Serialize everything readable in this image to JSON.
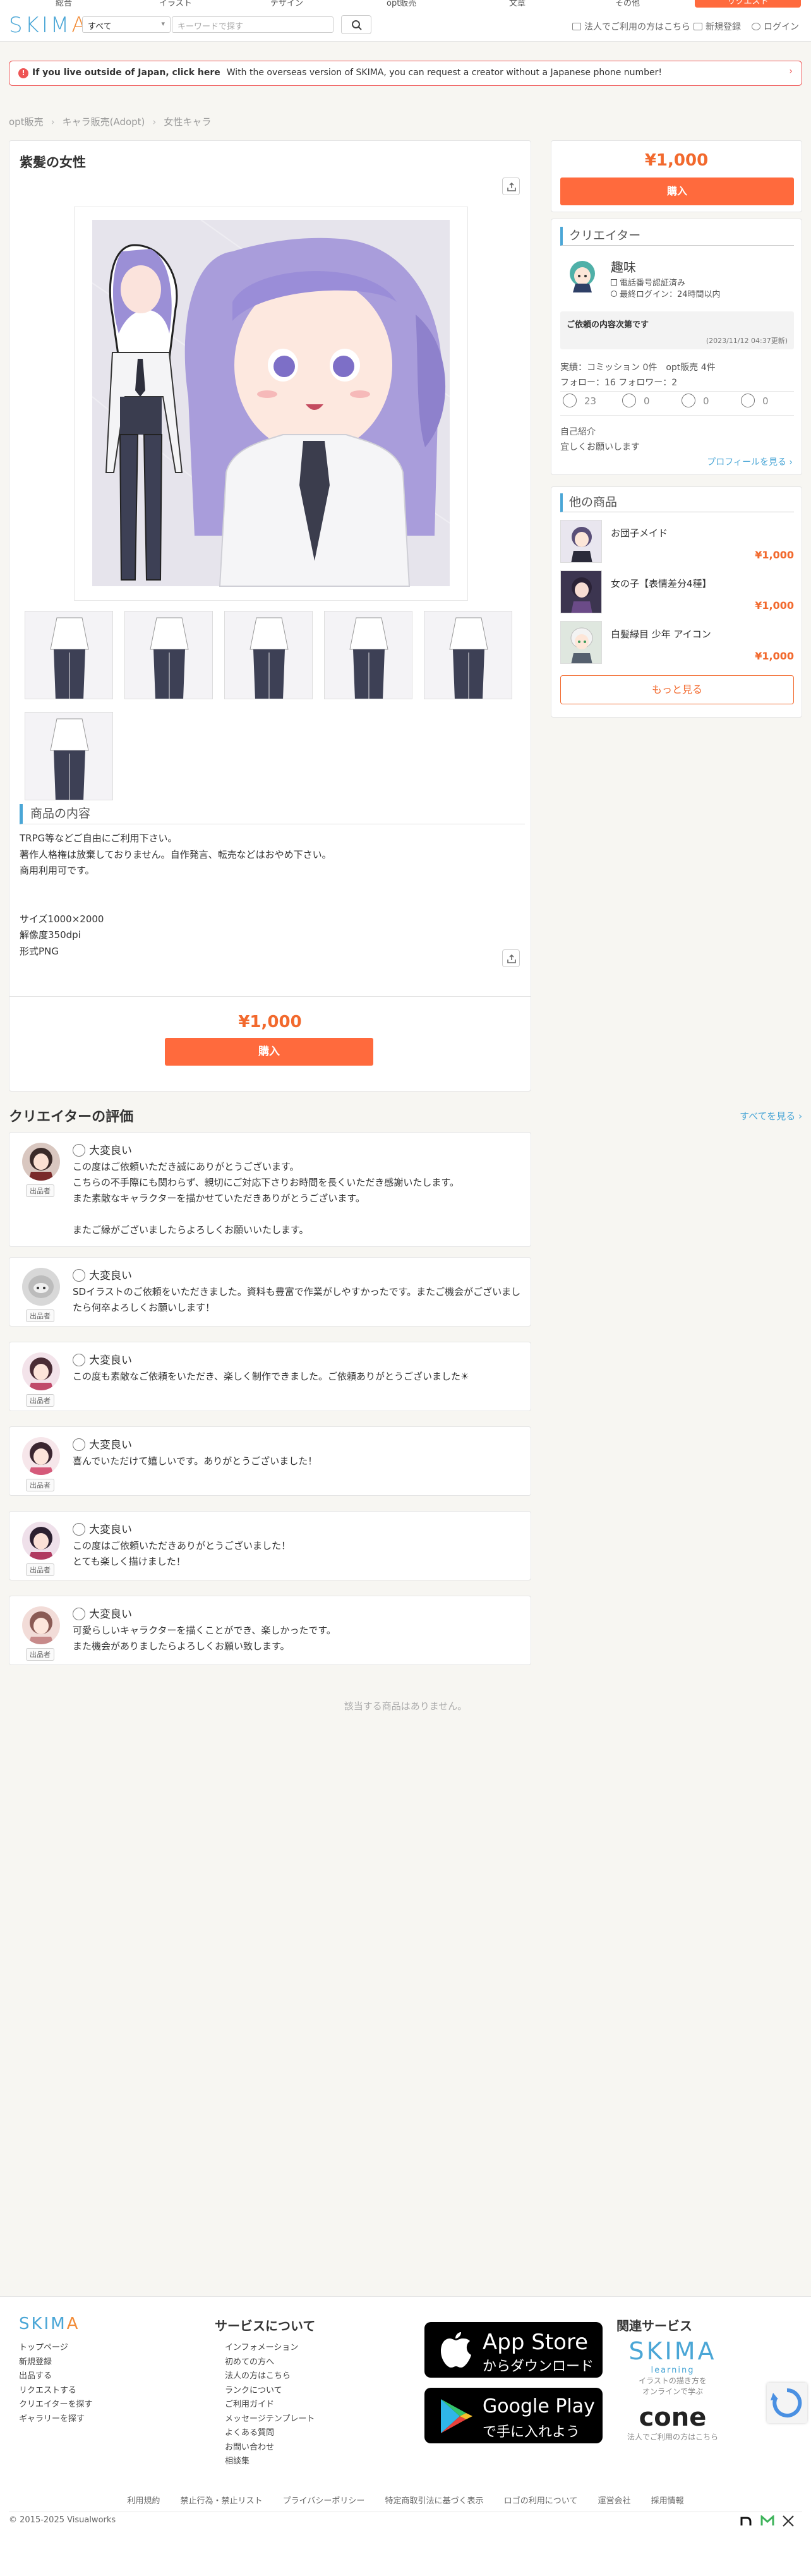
{
  "top_categories": [
    "総合",
    "イラスト",
    "デザイン",
    "opt販売",
    "文章",
    "その他"
  ],
  "top_cta": "リクエスト",
  "header": {
    "logo_main": "SKIM",
    "logo_accent": "A",
    "category_select": "すべて",
    "search_placeholder": "キーワードで探す",
    "link_corporate": "法人でご利用の方はこちら",
    "link_register": "新規登録",
    "link_login": "ログイン"
  },
  "notice": {
    "bold": "If you live outside of Japan, click here",
    "text": "With the overseas version of SKIMA, you can request a creator without a Japanese phone number!"
  },
  "breadcrumb": [
    "opt販売",
    "キャラ販売(Adopt)",
    "女性キャラ"
  ],
  "product": {
    "title": "紫髪の女性",
    "description_heading": "商品の内容",
    "description": "TRPG等などご自由にご利用下さい。\n著作人格権は放棄しておりません。自作発言、転売などはおやめ下さい。\n商用利用可です。\n\n\nサイズ1000×2000\n解像度350dpi\n形式PNG",
    "price": "¥1,000",
    "buy_label": "購入"
  },
  "sidebar": {
    "price": "¥1,000",
    "buy_label": "購入",
    "creator_heading": "クリエイター",
    "creator_name": "趣味",
    "verified": "電話番号認証済み",
    "last_login": "最終ログイン：24時間以内",
    "request_label": "ご依頼の内容次第です",
    "request_date": "(2023/11/12 04:37更新)",
    "stats": "実績：コミッション 0件　opt販売 4件",
    "follow": "フォロー：16 フォロワー：2",
    "ratings": [
      "23",
      "0",
      "0",
      "0"
    ],
    "intro_label": "自己紹介",
    "intro_text": "宜しくお願いします",
    "profile_link": "プロフィールを見る ›",
    "other_heading": "他の商品",
    "others": [
      {
        "title": "お団子メイド",
        "price": "¥1,000"
      },
      {
        "title": "女の子【表情差分4種】",
        "price": "¥1,000"
      },
      {
        "title": "白髪緑目 少年 アイコン",
        "price": "¥1,000"
      }
    ],
    "more_label": "もっと見る"
  },
  "reviews": {
    "heading": "クリエイターの評価",
    "see_all": "すべてを見る ›",
    "role": "出品者",
    "items": [
      {
        "rating": "大変良い",
        "text": "この度はご依頼いただき誠にありがとうございます。\nこちらの不手際にも関わらず、親切にご対応下さりお時間を長くいただき感謝いたします。\nまた素敵なキャラクターを描かせていただきありがとうございます。\n\nまたご縁がございましたらよろしくお願いいたします。"
      },
      {
        "rating": "大変良い",
        "text": "SDイラストのご依頼をいただきました。資料も豊富で作業がしやすかったです。またご機会がございましたら何卒よろしくお願いします！"
      },
      {
        "rating": "大変良い",
        "text": "この度も素敵なご依頼をいただき、楽しく制作できました。ご依頼ありがとうございました☀"
      },
      {
        "rating": "大変良い",
        "text": "喜んでいただけて嬉しいです。ありがとうございました！"
      },
      {
        "rating": "大変良い",
        "text": "この度はご依頼いただきありがとうございました！\nとても楽しく描けました！"
      },
      {
        "rating": "大変良い",
        "text": "可愛らしいキャラクターを描くことができ、楽しかったです。\nまた機会がありましたらよろしくお願い致します。"
      }
    ]
  },
  "no_items": "該当する商品はありません。",
  "footer": {
    "col1": [
      "トップページ",
      "新規登録",
      "出品する",
      "リクエストする",
      "クリエイターを探す",
      "ギャラリーを探す"
    ],
    "about_heading": "サービスについて",
    "col2": [
      "インフォメーション",
      "初めての方へ",
      "法人の方はこちら",
      "ランクについて",
      "ご利用ガイド",
      "メッセージテンプレート",
      "よくある質問",
      "お問い合わせ",
      "相談集"
    ],
    "appstore_main": "App Store",
    "appstore_sub": "からダウンロード",
    "gplay_main": "Google Play",
    "gplay_sub": "で手に入れよう",
    "related_heading": "関連サービス",
    "skima_learning": "SKIMA",
    "skima_learning_sub": "learning",
    "skima_learning_desc": "イラストの描き方を\nオンラインで学ぶ",
    "cone": "cone",
    "cone_desc": "法人でご利用の方はこちら",
    "links": [
      "利用規約",
      "禁止行為・禁止リスト",
      "プライバシーポリシー",
      "特定商取引法に基づく表示",
      "ロゴの利用について",
      "運営会社",
      "採用情報"
    ],
    "copyright": "© 2015-2025 Visualworks"
  },
  "colors": {
    "accent": "#ff6a3d",
    "price": "#f2692d",
    "link": "#4aa6d6"
  }
}
